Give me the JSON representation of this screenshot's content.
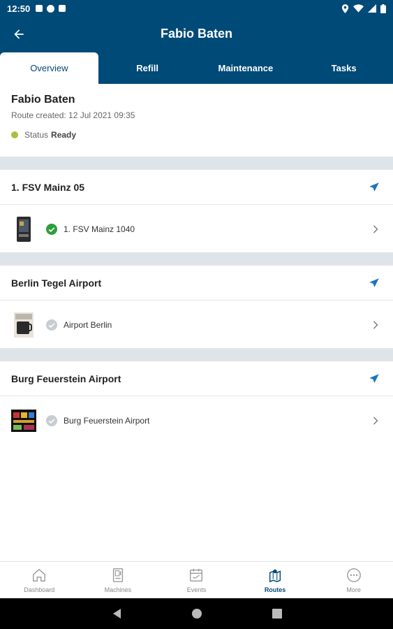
{
  "status_bar": {
    "time": "12:50"
  },
  "app_bar": {
    "title": "Fabio Baten"
  },
  "tabs": [
    {
      "label": "Overview",
      "active": true
    },
    {
      "label": "Refill",
      "active": false
    },
    {
      "label": "Maintenance",
      "active": false
    },
    {
      "label": "Tasks",
      "active": false
    }
  ],
  "route": {
    "name": "Fabio Baten",
    "created": "Route created: 12 Jul 2021 09:35",
    "status_label": "Status",
    "status_value": "Ready",
    "status_color": "#a7c23a"
  },
  "locations": [
    {
      "name": "1. FSV Mainz 05",
      "machines": [
        {
          "name": "1. FSV Mainz 1040",
          "status": "ok"
        }
      ]
    },
    {
      "name": "Berlin Tegel Airport",
      "machines": [
        {
          "name": "Airport Berlin",
          "status": "pending"
        }
      ]
    },
    {
      "name": "Burg Feuerstein Airport",
      "machines": [
        {
          "name": "Burg Feuerstein Airport",
          "status": "pending"
        }
      ]
    }
  ],
  "bottom_nav": [
    {
      "label": "Dashboard",
      "icon": "home-icon",
      "active": false
    },
    {
      "label": "Machines",
      "icon": "machine-icon",
      "active": false
    },
    {
      "label": "Events",
      "icon": "events-icon",
      "active": false
    },
    {
      "label": "Routes",
      "icon": "routes-icon",
      "active": true
    },
    {
      "label": "More",
      "icon": "more-icon",
      "active": false
    }
  ],
  "colors": {
    "primary": "#004a78",
    "accent": "#1a73c4",
    "ok": "#2e9e3c",
    "pending": "#c8cdd2"
  }
}
